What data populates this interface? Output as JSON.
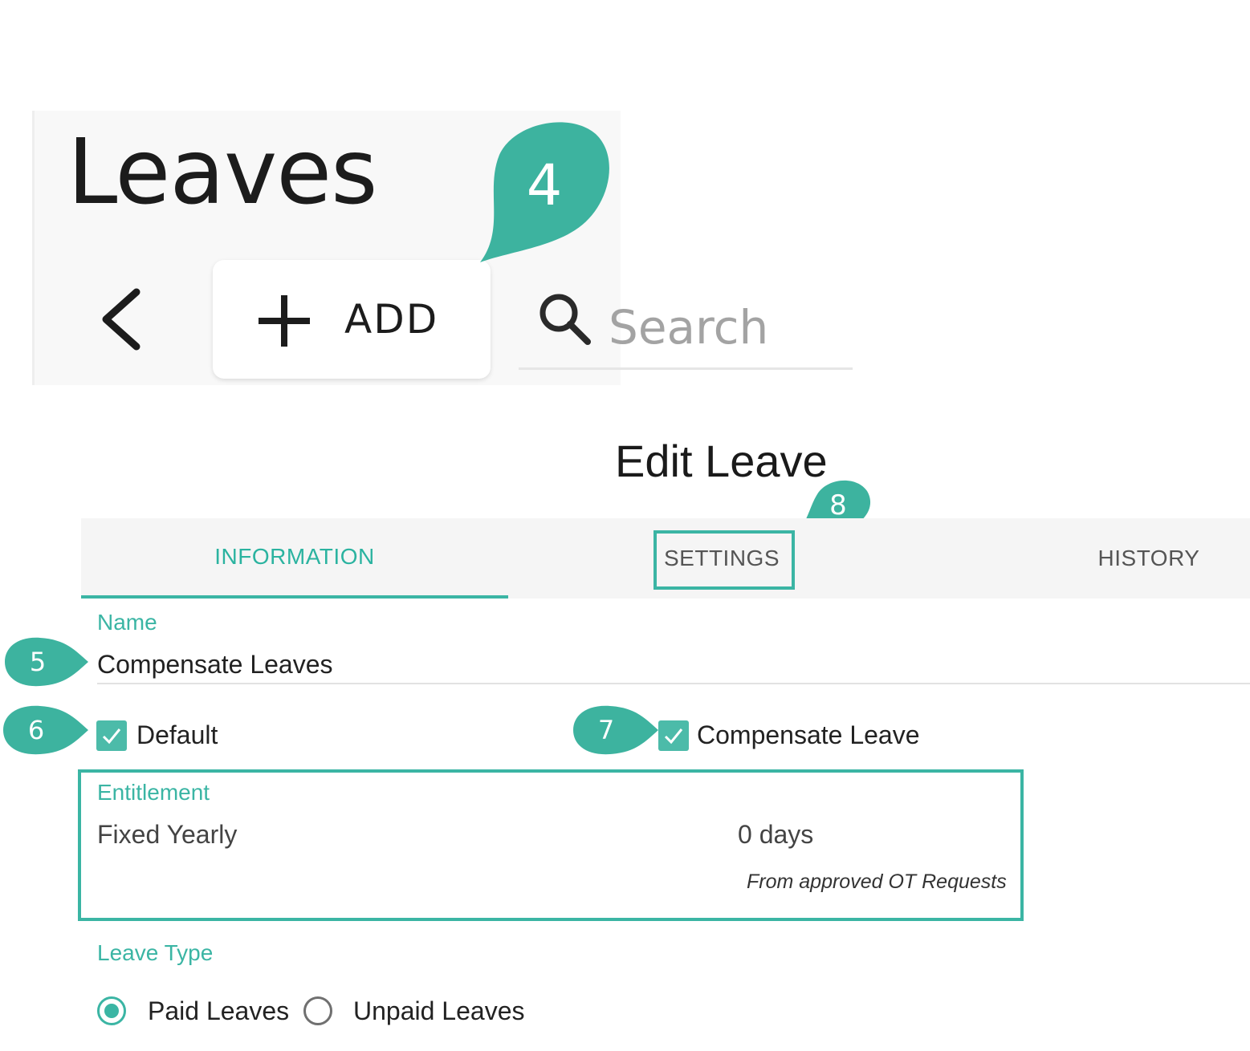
{
  "header": {
    "title": "Leaves",
    "add_label": "ADD",
    "search_placeholder": "Search"
  },
  "form": {
    "title": "Edit Leave",
    "tabs": [
      {
        "label": "INFORMATION",
        "active": true
      },
      {
        "label": "SETTINGS",
        "active": false
      },
      {
        "label": "HISTORY",
        "active": false
      }
    ],
    "name_label": "Name",
    "name_value": "Compensate Leaves",
    "default_label": "Default",
    "default_checked": true,
    "compensate_label": "Compensate Leave",
    "compensate_checked": true,
    "entitlement_label": "Entitlement",
    "entitlement_type": "Fixed Yearly",
    "entitlement_days": "0 days",
    "entitlement_note": "From approved OT Requests",
    "leave_type_label": "Leave Type",
    "leave_type_options": [
      {
        "label": "Paid Leaves",
        "selected": true
      },
      {
        "label": "Unpaid Leaves",
        "selected": false
      }
    ]
  },
  "callouts": [
    "4",
    "5",
    "6",
    "7",
    "8"
  ],
  "colors": {
    "accent": "#3bb5a4",
    "callout": "#3db39f",
    "text": "#222222"
  },
  "icons": {
    "back": "chevron-left-icon",
    "add": "plus-icon",
    "search": "search-icon",
    "check": "check-icon"
  }
}
